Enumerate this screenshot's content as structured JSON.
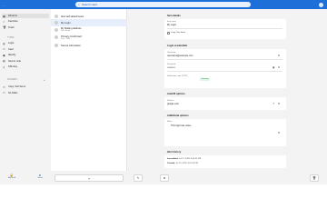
{
  "titlebar": {
    "dots": "···",
    "search_placeholder": "Search vault",
    "search_icon": "search-icon"
  },
  "sidebar": {
    "top_items": [
      {
        "label": "All items",
        "icon": "grid-icon",
        "active": true
      },
      {
        "label": "Favorites",
        "icon": "star-icon"
      },
      {
        "label": "Trash",
        "icon": "trash-icon"
      }
    ],
    "types_header": "TYPES",
    "type_items": [
      {
        "label": "Login",
        "icon": "globe-icon"
      },
      {
        "label": "Card",
        "icon": "card-icon"
      },
      {
        "label": "Identity",
        "icon": "id-icon"
      },
      {
        "label": "Secure note",
        "icon": "note-icon"
      },
      {
        "label": "SSH key",
        "icon": "key-icon"
      }
    ],
    "folders_header": "FOLDERS",
    "folder_items": [
      {
        "label": "Copy: Saz Items",
        "icon": "folder-icon"
      },
      {
        "label": "No folder",
        "icon": "folder-icon"
      }
    ],
    "bottom": {
      "vault_label": "My vault",
      "send_label": "Send"
    }
  },
  "list": {
    "items": [
      {
        "title": "Item with attachments",
        "subtitle": ""
      },
      {
        "title": "My Login",
        "subtitle": "",
        "selected": true
      },
      {
        "title": "My Mailing Address",
        "subtitle": "John Smith"
      },
      {
        "title": "Primary Credit Card",
        "subtitle": "Visa, *1234"
      },
      {
        "title": "Secure information",
        "subtitle": ""
      }
    ],
    "add_label": "+"
  },
  "detail": {
    "item_details_title": "Item details",
    "item_name_label": "Item name",
    "item_name_value": "My Login",
    "folder_label": "Copy: Saz Items",
    "login_credentials_title": "Login credentials",
    "username_label": "Username",
    "username_value": "username@example.com",
    "password_label": "Password",
    "password_value": "••••••••••",
    "totp_label": "Verification code (TOTP)",
    "totp_badge": "Premium",
    "autofill_title": "Autofill options",
    "website_label": "Website",
    "website_value": "google.com",
    "additional_title": "Additional options",
    "notes_label": "Notes",
    "notes_value": "This login has notes",
    "history_title": "Item history",
    "last_edited_label": "Last edited:",
    "last_edited_value": "Jul 13, 2026, 9:01:54 PM",
    "created_label": "Created:",
    "created_value": "Jul 13, 2026, 9:01:54 PM"
  },
  "footer": {
    "edit_icon": "pencil-icon",
    "clone_icon": "clone-icon",
    "delete_icon": "trash-icon"
  }
}
